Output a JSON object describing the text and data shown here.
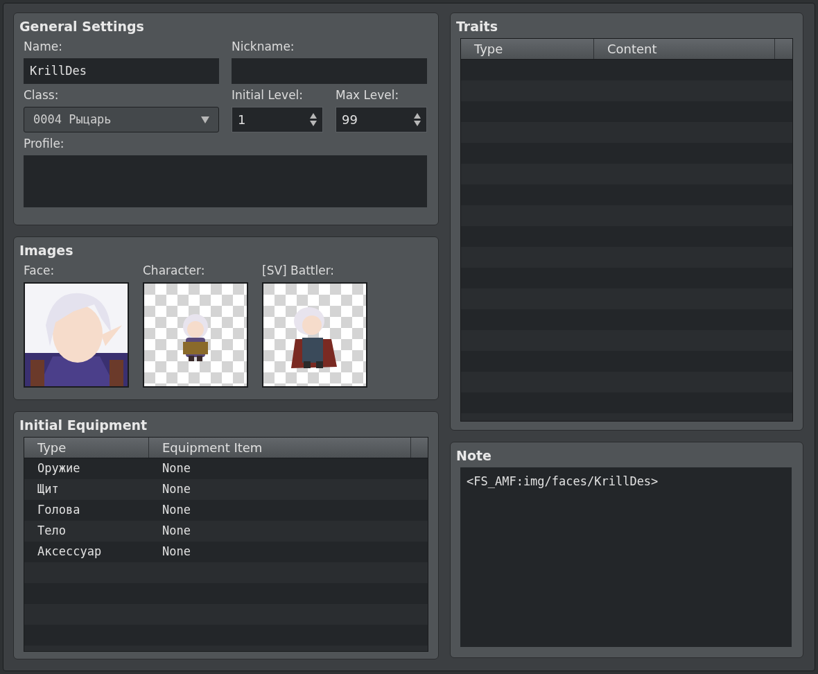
{
  "general_settings": {
    "title": "General Settings",
    "name": {
      "label": "Name:",
      "value": "KrillDes"
    },
    "nickname": {
      "label": "Nickname:"
    },
    "class": {
      "label": "Class:",
      "value": "0004 Рыцарь"
    },
    "initial_level": {
      "label": "Initial Level:",
      "value": "1"
    },
    "max_level": {
      "label": "Max Level:",
      "value": "99"
    },
    "profile": {
      "label": "Profile:"
    }
  },
  "images": {
    "title": "Images",
    "slots": [
      {
        "label": "Face:",
        "kind": "face"
      },
      {
        "label": "Character:",
        "kind": "sprite"
      },
      {
        "label": "[SV] Battler:",
        "kind": "sprite"
      }
    ]
  },
  "initial_equipment": {
    "title": "Initial Equipment",
    "columns": [
      "Type",
      "Equipment Item"
    ],
    "rows": [
      [
        "Оружие",
        "None"
      ],
      [
        "Щит",
        "None"
      ],
      [
        "Голова",
        "None"
      ],
      [
        "Тело",
        "None"
      ],
      [
        "Аксессуар",
        "None"
      ]
    ]
  },
  "traits": {
    "title": "Traits",
    "columns": [
      "Type",
      "Content"
    ]
  },
  "note": {
    "title": "Note",
    "value": "<FS_AMF:img/faces/KrillDes>"
  }
}
